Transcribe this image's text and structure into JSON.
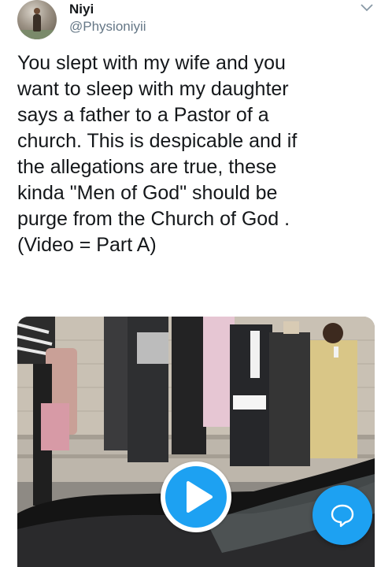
{
  "tweet": {
    "author_name": "Niyi",
    "author_handle": "@Physioniyii",
    "text": "You slept with my wife and you\nwant to sleep with my daughter\nsays a father to a Pastor of a\nchurch. This is despicable and if\nthe allegations are true, these\nkinda \"Men of God\" should be\npurge from the Church of God .\n(Video = Part A)"
  },
  "media": {
    "type": "video",
    "play_icon": "play-icon"
  },
  "icons": {
    "menu": "chevron-down-icon",
    "compose": "speech-bubble-icon"
  },
  "colors": {
    "accent": "#1da1f2",
    "text_primary": "#14171a",
    "text_secondary": "#657786"
  }
}
